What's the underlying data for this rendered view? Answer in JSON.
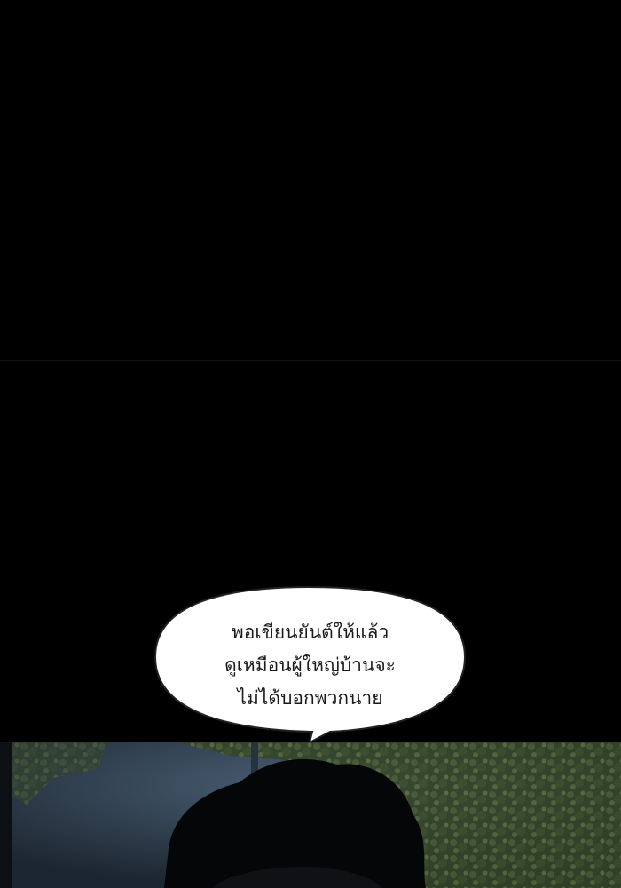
{
  "colors": {
    "background": "#000000",
    "bubble_fill": "#ffffff",
    "foliage": "#3a4a2a",
    "sky": "#2c3a48"
  },
  "dialogue": {
    "lines": [
      "พอเขียนยันต์ให้แล้ว",
      "ดูเหมือนผู้ใหญ่บ้านจะ",
      "ไม่ได้บอกพวกนาย"
    ]
  }
}
